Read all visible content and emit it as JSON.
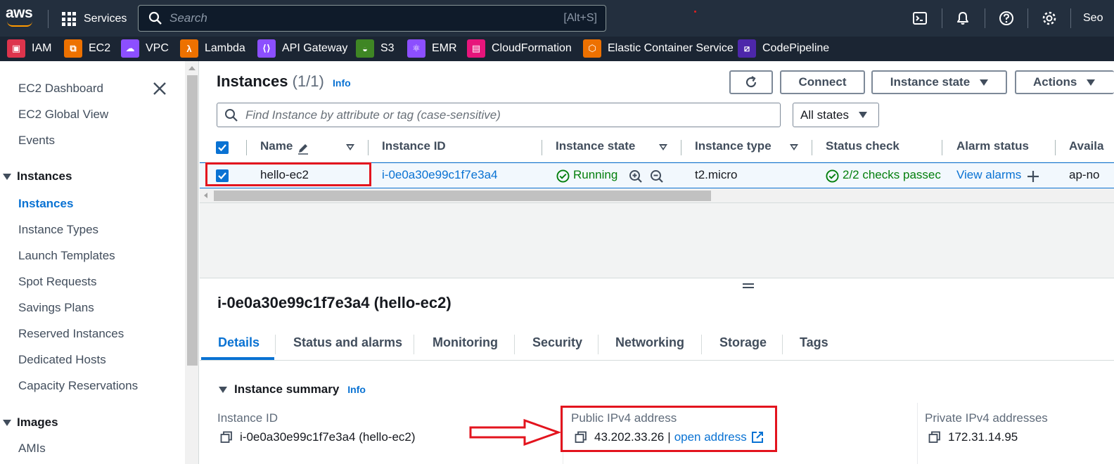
{
  "topnav": {
    "logo": "aws",
    "services_label": "Services",
    "search_placeholder": "Search",
    "search_shortcut": "[Alt+S]",
    "user_label": "Seo"
  },
  "favorites": [
    {
      "label": "IAM",
      "color": "#dd344c",
      "icon": "iam-icon"
    },
    {
      "label": "EC2",
      "color": "#ed7100",
      "icon": "ec2-icon"
    },
    {
      "label": "VPC",
      "color": "#8c4fff",
      "icon": "vpc-icon"
    },
    {
      "label": "Lambda",
      "color": "#ed7100",
      "icon": "lambda-icon"
    },
    {
      "label": "API Gateway",
      "color": "#8c4fff",
      "icon": "api-gateway-icon"
    },
    {
      "label": "S3",
      "color": "#3f8624",
      "icon": "s3-icon"
    },
    {
      "label": "EMR",
      "color": "#8c4fff",
      "icon": "emr-icon"
    },
    {
      "label": "CloudFormation",
      "color": "#e7157b",
      "icon": "cloudformation-icon"
    },
    {
      "label": "Elastic Container Service",
      "color": "#ed7100",
      "icon": "ecs-icon"
    },
    {
      "label": "CodePipeline",
      "color": "#4d27aa",
      "icon": "codepipeline-icon"
    }
  ],
  "sidebar": {
    "items": [
      {
        "label": "EC2 Dashboard"
      },
      {
        "label": "EC2 Global View"
      },
      {
        "label": "Events"
      }
    ],
    "instances_section": "Instances",
    "instances_items": [
      {
        "label": "Instances"
      },
      {
        "label": "Instance Types"
      },
      {
        "label": "Launch Templates"
      },
      {
        "label": "Spot Requests"
      },
      {
        "label": "Savings Plans"
      },
      {
        "label": "Reserved Instances"
      },
      {
        "label": "Dedicated Hosts"
      },
      {
        "label": "Capacity Reservations"
      }
    ],
    "images_section": "Images",
    "images_items": [
      {
        "label": "AMIs"
      }
    ]
  },
  "main": {
    "title": "Instances",
    "count": "(1/1)",
    "info": "Info",
    "buttons": {
      "connect": "Connect",
      "instance_state": "Instance state",
      "actions": "Actions"
    },
    "filter_placeholder": "Find Instance by attribute or tag (case-sensitive)",
    "states_filter": "All states",
    "columns": [
      "Name",
      "Instance ID",
      "Instance state",
      "Instance type",
      "Status check",
      "Alarm status",
      "Availa"
    ],
    "row": {
      "name": "hello-ec2",
      "instance_id": "i-0e0a30e99c1f7e3a4",
      "state": "Running",
      "type": "t2.micro",
      "status_check": "2/2 checks passec",
      "alarm": "View alarms",
      "az": "ap-no"
    }
  },
  "details": {
    "title": "i-0e0a30e99c1f7e3a4 (hello-ec2)",
    "tabs": [
      "Details",
      "Status and alarms",
      "Monitoring",
      "Security",
      "Networking",
      "Storage",
      "Tags"
    ],
    "summary_label": "Instance summary",
    "summary_info": "Info",
    "instance_id_label": "Instance ID",
    "instance_id_value": "i-0e0a30e99c1f7e3a4 (hello-ec2)",
    "public_ip_label": "Public IPv4 address",
    "public_ip_value": "43.202.33.26",
    "separator": "|",
    "open_address": "open address",
    "private_ip_label": "Private IPv4 addresses",
    "private_ip_value": "172.31.14.95"
  },
  "colors": {
    "nav_bg": "#232f3e",
    "link_blue": "#0972d3",
    "success_green": "#037f0c",
    "highlight_red": "#e3141e"
  }
}
